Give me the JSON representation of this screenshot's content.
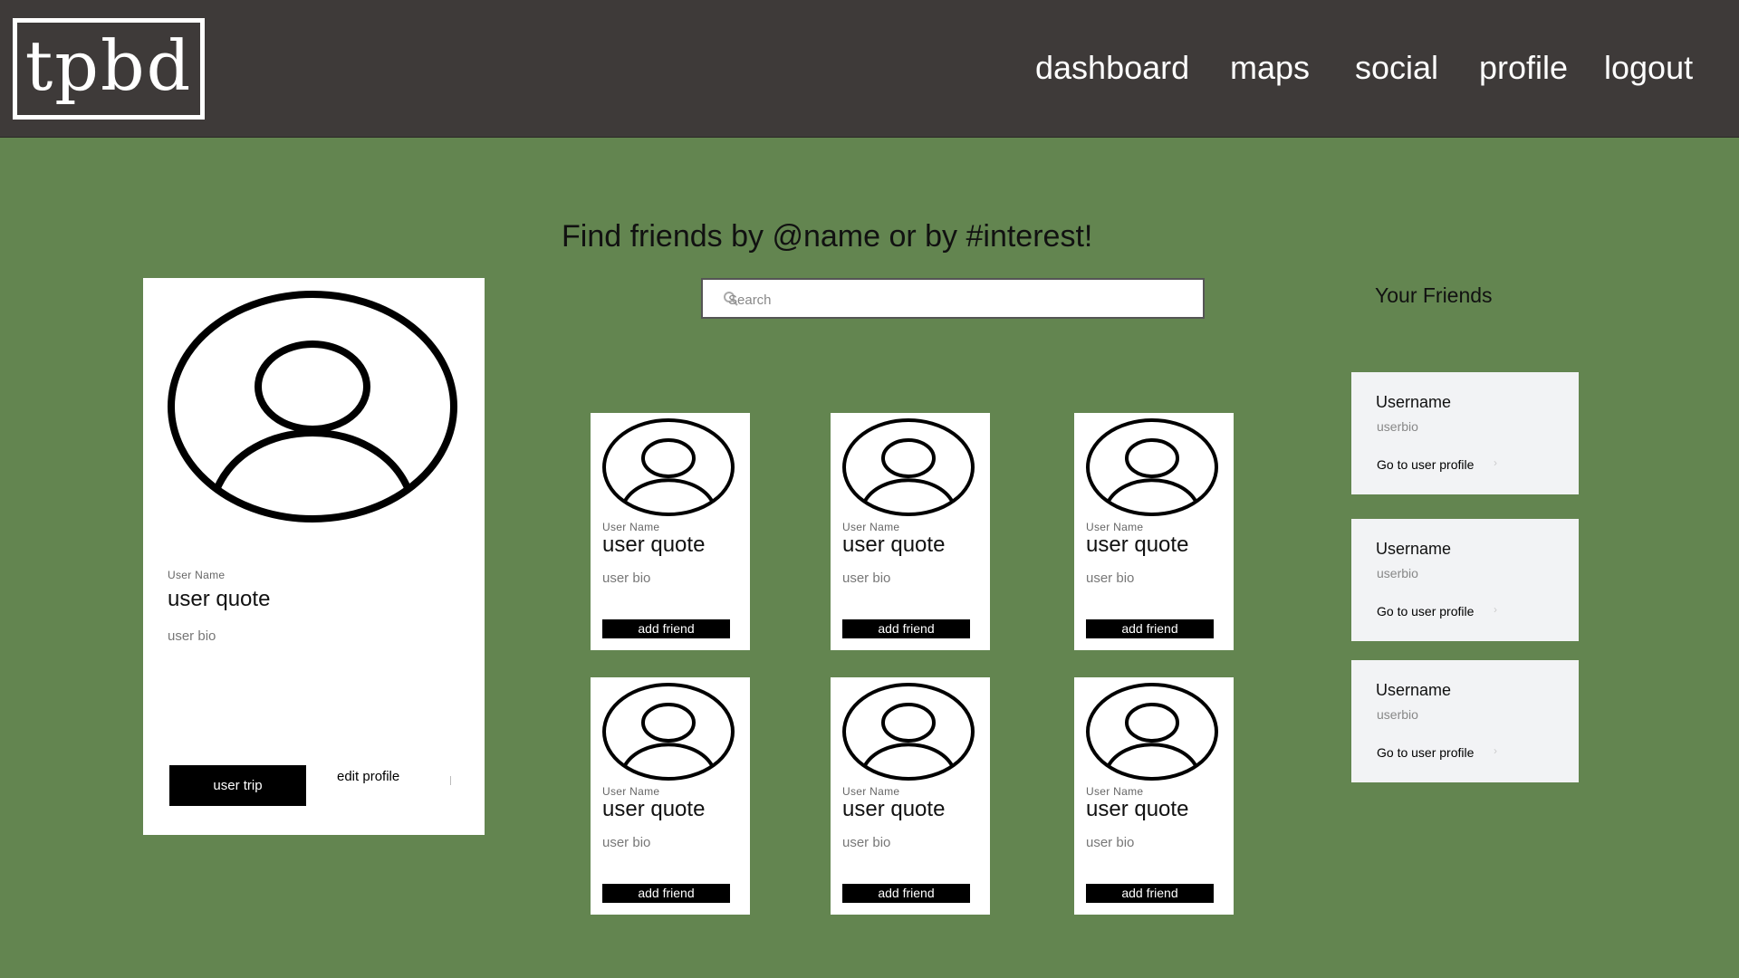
{
  "header": {
    "logo": "tpbd",
    "nav": [
      "dashboard",
      "maps",
      "social",
      "profile",
      "logout"
    ]
  },
  "main": {
    "headline": "Find friends by @name or by #interest!",
    "search": {
      "placeholder": "Search",
      "value": ""
    }
  },
  "profile_card": {
    "user_name": "User Name",
    "quote": "user quote",
    "bio": "user bio",
    "trip_button": "user trip",
    "edit_link": "edit profile"
  },
  "results": [
    {
      "user_name": "User Name",
      "quote": "user quote",
      "bio": "user bio",
      "button": "add friend"
    },
    {
      "user_name": "User Name",
      "quote": "user quote",
      "bio": "user bio",
      "button": "add friend"
    },
    {
      "user_name": "User Name",
      "quote": "user quote",
      "bio": "user bio",
      "button": "add friend"
    },
    {
      "user_name": "User Name",
      "quote": "user quote",
      "bio": "user bio",
      "button": "add friend"
    },
    {
      "user_name": "User Name",
      "quote": "user quote",
      "bio": "user bio",
      "button": "add friend"
    },
    {
      "user_name": "User Name",
      "quote": "user quote",
      "bio": "user bio",
      "button": "add friend"
    }
  ],
  "friends": {
    "title": "Your Friends",
    "items": [
      {
        "username": "Username",
        "bio": "userbio",
        "link": "Go to user profile"
      },
      {
        "username": "Username",
        "bio": "userbio",
        "link": "Go to user profile"
      },
      {
        "username": "Username",
        "bio": "userbio",
        "link": "Go to user profile"
      }
    ]
  },
  "colors": {
    "background": "#638550",
    "header": "#3e3a39",
    "card": "#ffffff",
    "friend_card": "#f2f3f5",
    "button": "#000000"
  },
  "icons": [
    "search-icon",
    "avatar-icon",
    "chevron-right-icon"
  ]
}
